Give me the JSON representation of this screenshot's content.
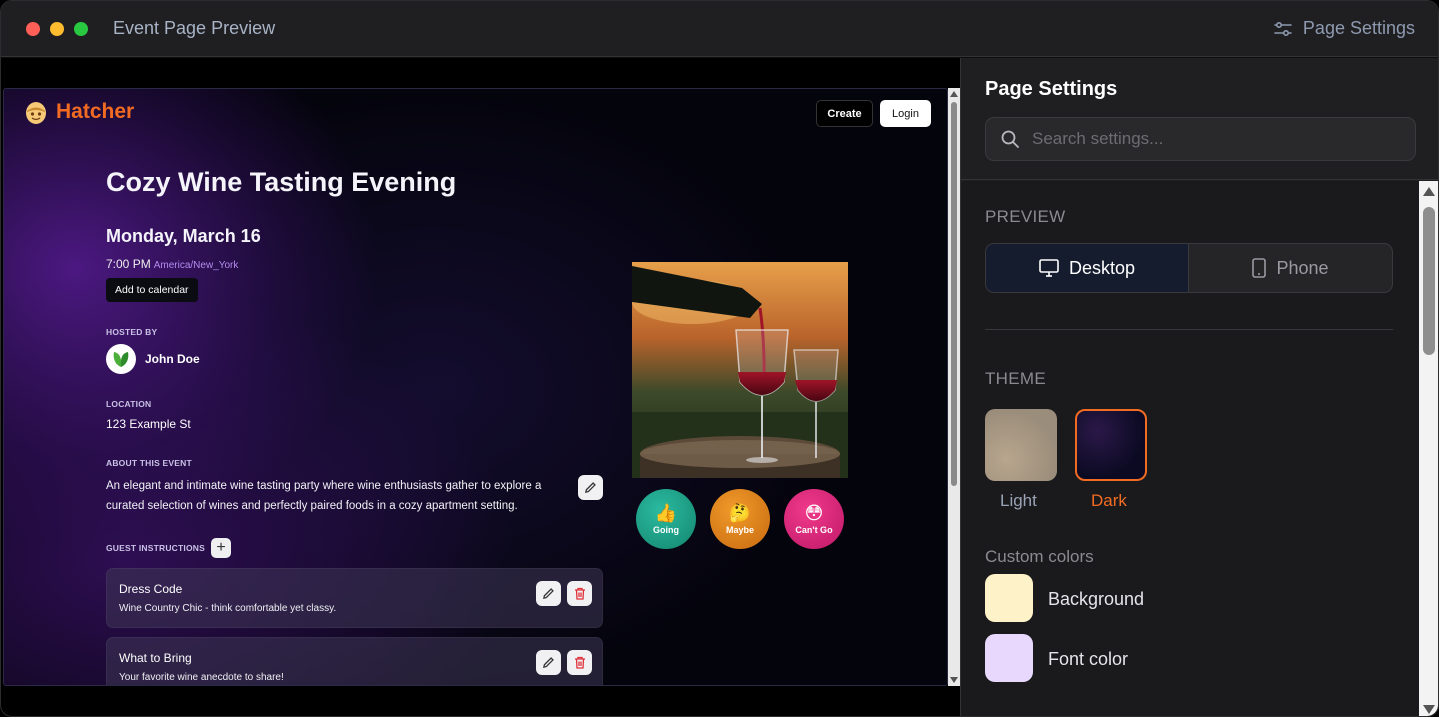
{
  "window": {
    "title": "Event Page Preview",
    "settings_link": "Page Settings"
  },
  "event": {
    "brand": "Hatcher",
    "nav": {
      "create": "Create",
      "login": "Login"
    },
    "title": "Cozy Wine Tasting Evening",
    "date": "Monday, March 16",
    "time": "7:00 PM",
    "timezone": "America/New_York",
    "add_to_calendar": "Add to calendar",
    "hosted_by_label": "HOSTED BY",
    "host_name": "John Doe",
    "location_label": "LOCATION",
    "location": "123 Example St",
    "about_label": "ABOUT THIS EVENT",
    "about_text": "An elegant and intimate wine tasting party where wine enthusiasts gather to explore a curated selection of wines and perfectly paired foods in a cozy apartment setting.",
    "guest_instructions_label": "GUEST INSTRUCTIONS",
    "guest_instructions": [
      {
        "title": "Dress Code",
        "desc": "Wine Country Chic - think comfortable yet classy."
      },
      {
        "title": "What to Bring",
        "desc": "Your favorite wine anecdote to share!"
      }
    ],
    "rsvp": [
      {
        "label": "Going",
        "emoji": "👍",
        "color": "#1a9f86"
      },
      {
        "label": "Maybe",
        "emoji": "🤔",
        "color": "#e0821c"
      },
      {
        "label": "Can't Go",
        "emoji": "😳",
        "color": "#de2a7c"
      }
    ]
  },
  "settings": {
    "title": "Page Settings",
    "search_placeholder": "Search settings...",
    "preview_label": "PREVIEW",
    "preview_options": [
      {
        "label": "Desktop",
        "icon": "monitor-icon",
        "selected": true
      },
      {
        "label": "Phone",
        "icon": "phone-icon",
        "selected": false
      }
    ],
    "theme_label": "THEME",
    "themes": [
      {
        "label": "Light",
        "selected": false
      },
      {
        "label": "Dark",
        "selected": true
      }
    ],
    "custom_colors_label": "Custom colors",
    "custom_colors": [
      {
        "label": "Background",
        "color": "#fef3c8"
      },
      {
        "label": "Font color",
        "color": "#e8d8fe"
      }
    ],
    "accent_color": "#f26b22"
  }
}
